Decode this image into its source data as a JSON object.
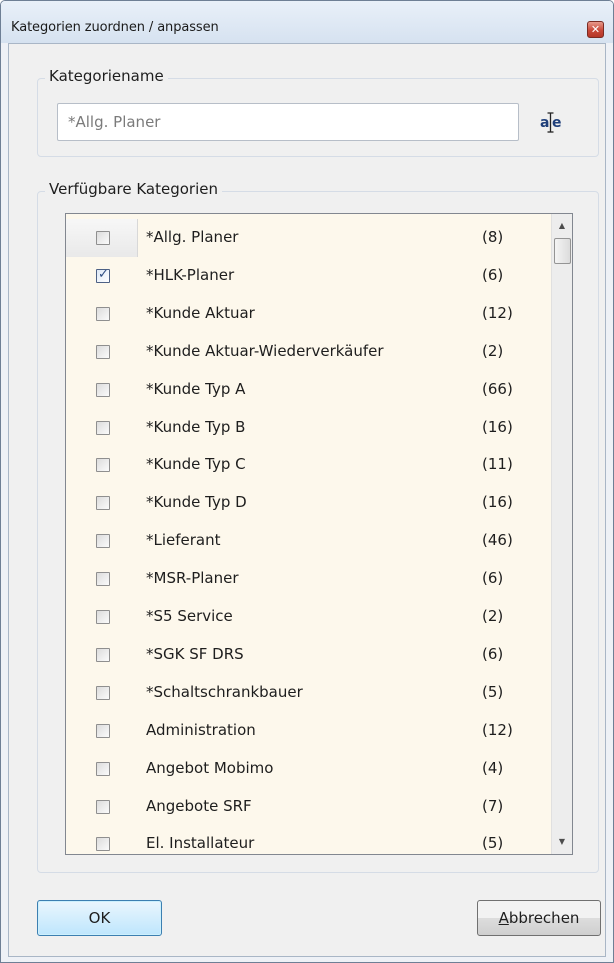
{
  "window": {
    "title": "Kategorien zuordnen / anpassen"
  },
  "name_group": {
    "legend": "Kategoriename",
    "input_value": "*Allg. Planer"
  },
  "list_group": {
    "legend": "Verfügbare Kategorien"
  },
  "categories": [
    {
      "name": "*Allg. Planer",
      "count": "(8)",
      "checked": false
    },
    {
      "name": "*HLK-Planer",
      "count": "(6)",
      "checked": true
    },
    {
      "name": "*Kunde Aktuar",
      "count": "(12)",
      "checked": false
    },
    {
      "name": "*Kunde Aktuar-Wiederverkäufer",
      "count": "(2)",
      "checked": false
    },
    {
      "name": "*Kunde Typ A",
      "count": "(66)",
      "checked": false
    },
    {
      "name": "*Kunde Typ B",
      "count": "(16)",
      "checked": false
    },
    {
      "name": "*Kunde Typ C",
      "count": "(11)",
      "checked": false
    },
    {
      "name": "*Kunde Typ D",
      "count": "(16)",
      "checked": false
    },
    {
      "name": "*Lieferant",
      "count": "(46)",
      "checked": false
    },
    {
      "name": "*MSR-Planer",
      "count": "(6)",
      "checked": false
    },
    {
      "name": "*S5 Service",
      "count": "(2)",
      "checked": false
    },
    {
      "name": "*SGK SF DRS",
      "count": "(6)",
      "checked": false
    },
    {
      "name": "*Schaltschrankbauer",
      "count": "(5)",
      "checked": false
    },
    {
      "name": "Administration",
      "count": "(12)",
      "checked": false
    },
    {
      "name": "Angebot Mobimo",
      "count": "(4)",
      "checked": false
    },
    {
      "name": "Angebote SRF",
      "count": "(7)",
      "checked": false
    },
    {
      "name": "El. Installateur",
      "count": "(5)",
      "checked": false
    }
  ],
  "buttons": {
    "ok": "OK",
    "cancel_mnemonic": "A",
    "cancel_rest": "bbrechen"
  },
  "icons": {
    "close": "close-icon",
    "rename": "rename-text-icon",
    "scroll_up": "scroll-up-icon",
    "scroll_down": "scroll-down-icon"
  },
  "colors": {
    "list_background": "#fdf8ec",
    "ok_button": "#bee6fd",
    "close_button": "#c9493a",
    "checkmark": "#2f4d82"
  }
}
